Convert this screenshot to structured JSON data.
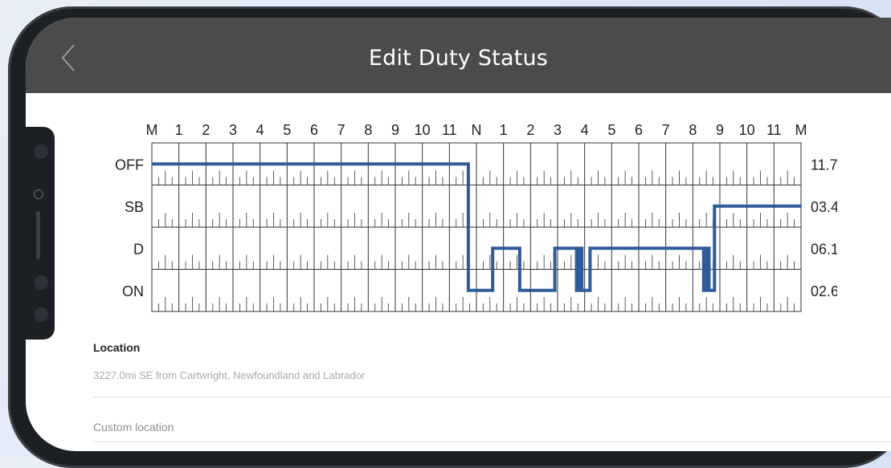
{
  "header": {
    "title": "Edit Duty Status"
  },
  "log": {
    "hour_labels": [
      "M",
      "1",
      "2",
      "3",
      "4",
      "5",
      "6",
      "7",
      "8",
      "9",
      "10",
      "11",
      "N",
      "1",
      "2",
      "3",
      "4",
      "5",
      "6",
      "7",
      "8",
      "9",
      "10",
      "11",
      "M"
    ],
    "rows": [
      {
        "label": "OFF",
        "total": "11.73"
      },
      {
        "label": "SB",
        "total": "03.41"
      },
      {
        "label": "D",
        "total": "06.19"
      },
      {
        "label": "ON",
        "total": "02.67"
      }
    ],
    "line_color": "#2f5b98",
    "duty_path": [
      [
        0,
        "OFF"
      ],
      [
        11.7,
        "OFF"
      ],
      [
        11.7,
        "ON"
      ],
      [
        12.6,
        "ON"
      ],
      [
        12.6,
        "D"
      ],
      [
        13.6,
        "D"
      ],
      [
        13.6,
        "ON"
      ],
      [
        14.9,
        "ON"
      ],
      [
        14.9,
        "D"
      ],
      [
        15.7,
        "D"
      ],
      [
        15.7,
        "ON"
      ],
      [
        15.8,
        "ON"
      ],
      [
        15.8,
        "D"
      ],
      [
        15.9,
        "D"
      ],
      [
        15.9,
        "ON"
      ],
      [
        16.2,
        "ON"
      ],
      [
        16.2,
        "D"
      ],
      [
        20.4,
        "D"
      ],
      [
        20.4,
        "ON"
      ],
      [
        20.5,
        "ON"
      ],
      [
        20.5,
        "D"
      ],
      [
        20.6,
        "D"
      ],
      [
        20.6,
        "ON"
      ],
      [
        20.8,
        "ON"
      ],
      [
        20.8,
        "SB"
      ],
      [
        24,
        "SB"
      ]
    ]
  },
  "location": {
    "label": "Location",
    "value": "3227.0mi SE from Cartwright, Newfoundland and Labrador"
  },
  "custom_location": {
    "placeholder": "Custom location"
  }
}
